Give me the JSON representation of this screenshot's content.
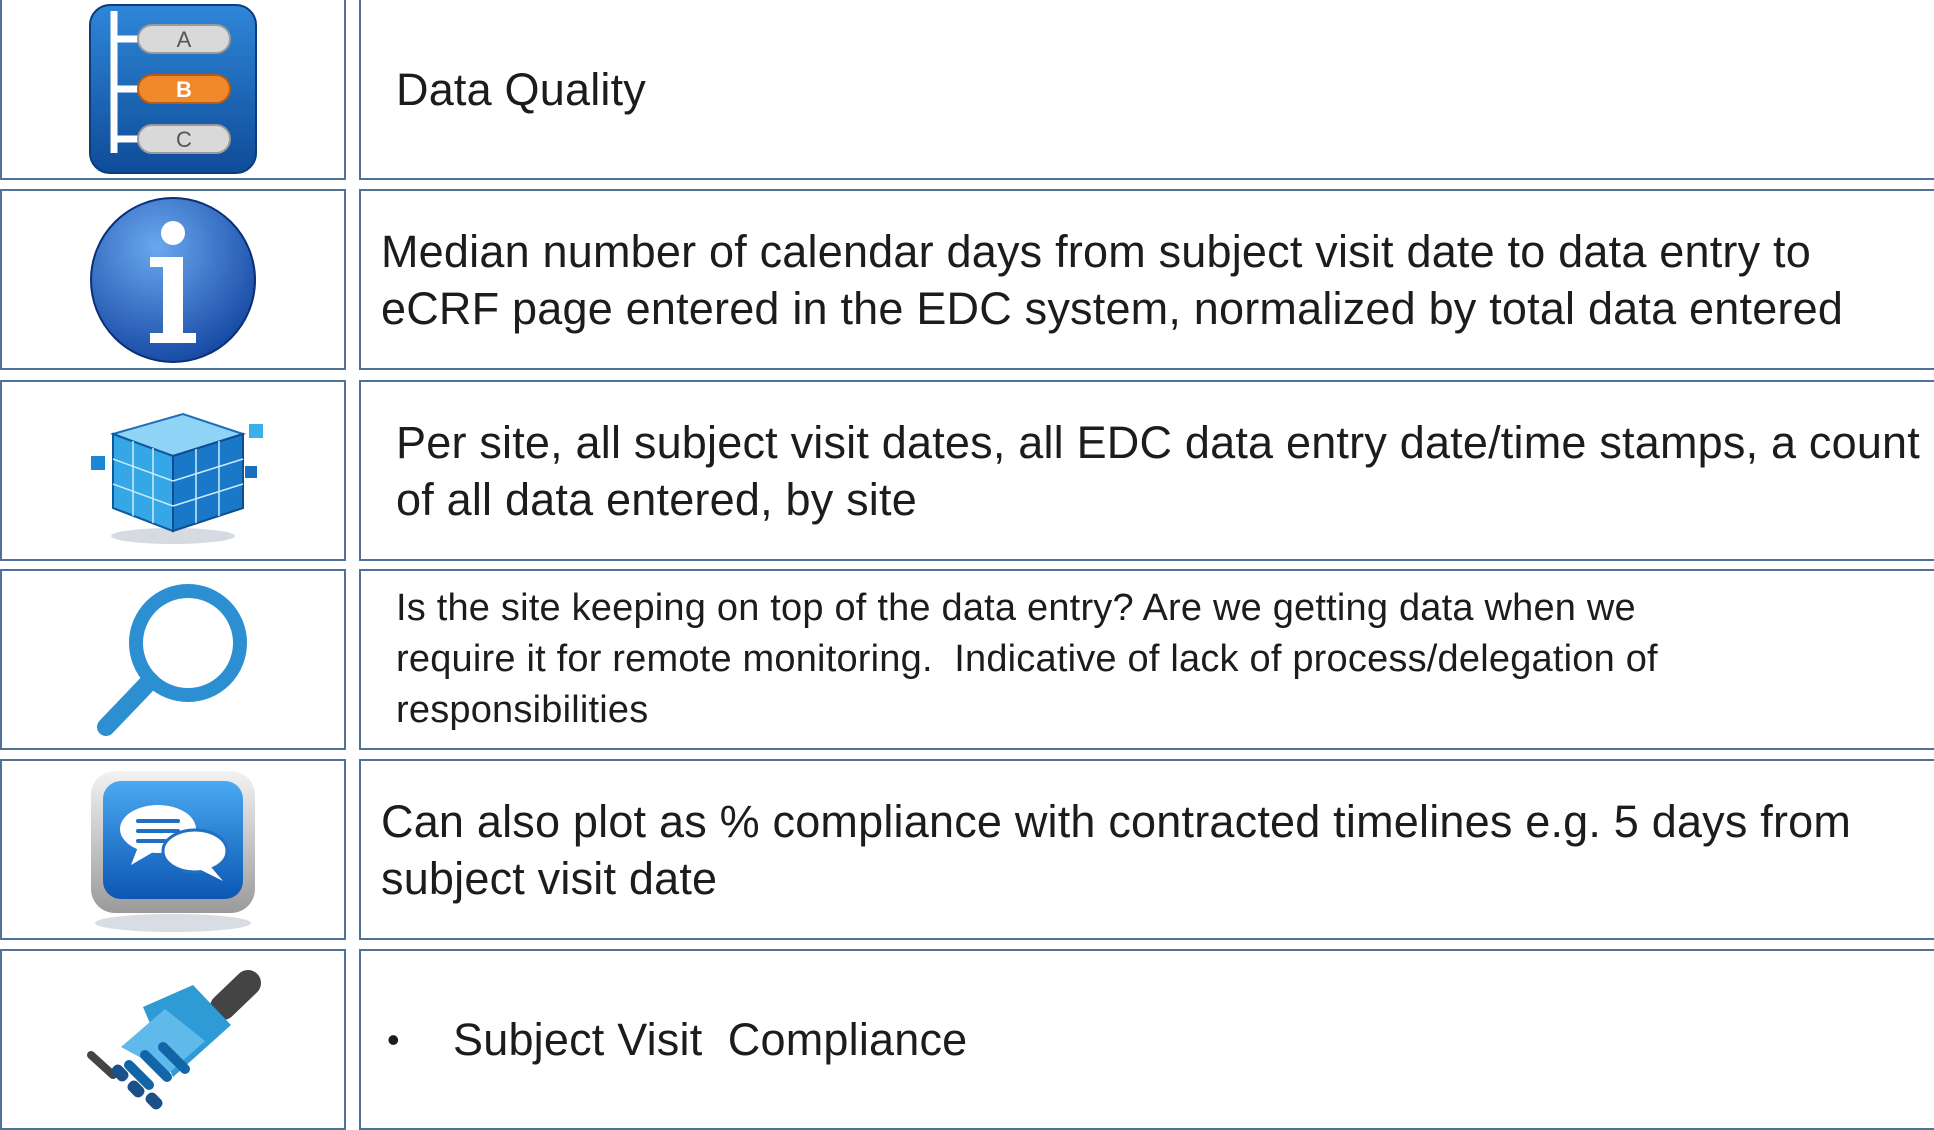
{
  "rows": [
    {
      "icon": "abc-list-icon",
      "icon_letters": [
        "A",
        "B",
        "C"
      ],
      "lines": [
        "Data Quality"
      ]
    },
    {
      "icon": "info-icon",
      "lines": [
        "Median number of calendar days from subject visit date to data entry to",
        "eCRF page entered in the EDC system, normalized by total data entered"
      ]
    },
    {
      "icon": "data-cube-icon",
      "lines": [
        "Per site, all subject visit dates, all EDC data entry date/time stamps, a count",
        "of all data entered, by site"
      ]
    },
    {
      "icon": "magnifier-icon",
      "lines": [
        "Is the site keeping on top of the data entry? Are we getting data when we",
        "require it for remote monitoring.  Indicative of lack of process/delegation of",
        "responsibilities"
      ]
    },
    {
      "icon": "chat-bubbles-icon",
      "lines": [
        "Can also plot as % compliance with contracted timelines e.g. 5 days from",
        "subject visit date"
      ]
    },
    {
      "icon": "handshake-icon",
      "bullet": "•",
      "lines": [
        "Subject Visit  Compliance"
      ]
    }
  ],
  "colors": {
    "border": "#4f7296",
    "blue": "#1f6fc4",
    "accent_orange": "#f0892b"
  }
}
